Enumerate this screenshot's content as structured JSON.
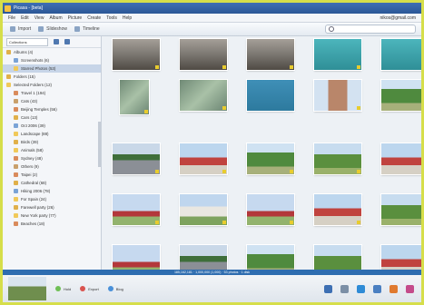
{
  "window": {
    "title": "Picasa - [beta]"
  },
  "menu": {
    "items": [
      "File",
      "Edit",
      "View",
      "Album",
      "Picture",
      "Create",
      "Tools",
      "Help"
    ],
    "account": "nikos@gmail.com"
  },
  "toolbar": {
    "buttons": [
      "Import",
      "Slideshow",
      "Timeline"
    ],
    "search_placeholder": ""
  },
  "sidebar": {
    "selector": "Collections",
    "items": [
      {
        "label": "Albums (4)"
      },
      {
        "label": "Screenshots (6)"
      },
      {
        "label": "Starred Photos (53)",
        "selected": true
      },
      {
        "label": "Folders (15)"
      },
      {
        "label": "Selected Folders (12)"
      },
      {
        "label": "Travel 1 (194)"
      },
      {
        "label": "Cats (43)"
      },
      {
        "label": "Beijing Temples (56)"
      },
      {
        "label": "Cars (13)"
      },
      {
        "label": "Oct 2006 (39)"
      },
      {
        "label": "Landscape (88)"
      },
      {
        "label": "Birds (39)"
      },
      {
        "label": "Animals (58)"
      },
      {
        "label": "Sydney (48)"
      },
      {
        "label": "Others (9)"
      },
      {
        "label": "Taipei (2)"
      },
      {
        "label": "Cathedral (68)"
      },
      {
        "label": "Hiking 2006 (78)"
      },
      {
        "label": "For Spain (24)"
      },
      {
        "label": "Farewell party (26)"
      },
      {
        "label": "New York party (77)"
      },
      {
        "label": "Beaches (18)"
      }
    ]
  },
  "gallery": {
    "thumbnails": [
      {
        "theme": "thumb-dusk",
        "tagged": true
      },
      {
        "theme": "thumb-dusk",
        "tagged": true
      },
      {
        "theme": "thumb-dusk",
        "tagged": true
      },
      {
        "theme": "thumb-teal",
        "tagged": true
      },
      {
        "theme": "thumb-teal",
        "tagged": true
      },
      {
        "theme": "thumb-aerial",
        "tagged": true
      },
      {
        "theme": "thumb-aerial",
        "tagged": true
      },
      {
        "theme": "thumb-water",
        "tagged": false
      },
      {
        "theme": "thumb-building",
        "tagged": true
      },
      {
        "theme": "thumb-park-tree",
        "tagged": true
      },
      {
        "theme": "thumb-road",
        "tagged": true
      },
      {
        "theme": "thumb-red-temple",
        "tagged": true
      },
      {
        "theme": "thumb-park-tree",
        "tagged": true
      },
      {
        "theme": "thumb-tree-lawn",
        "tagged": true
      },
      {
        "theme": "thumb-red-temple",
        "tagged": true
      },
      {
        "theme": "thumb-sky-temple",
        "tagged": true
      },
      {
        "theme": "thumb-white-bldg",
        "tagged": true
      },
      {
        "theme": "thumb-sky-temple",
        "tagged": true
      },
      {
        "theme": "thumb-red-temple",
        "tagged": true
      },
      {
        "theme": "thumb-tree-lawn",
        "tagged": true
      },
      {
        "theme": "thumb-sky-temple",
        "tagged": true
      },
      {
        "theme": "thumb-road",
        "tagged": true
      },
      {
        "theme": "thumb-park-tree",
        "tagged": true
      },
      {
        "theme": "thumb-tree-lawn",
        "tagged": true
      },
      {
        "theme": "thumb-red-temple",
        "tagged": true
      }
    ]
  },
  "status": {
    "text": "185,162,181 · 1,000,000 (1,000) · 53 photos · 1 disk"
  },
  "bottom": {
    "buttons": [
      "Hold",
      "Export",
      "Blog"
    ],
    "tray_icons": [
      "email-icon",
      "print-icon",
      "upload-icon",
      "order-icon",
      "collage-icon",
      "movie-icon"
    ]
  },
  "colors": {
    "accent": "#2f6db0",
    "title": "#3f6fb4",
    "tag": "#e8cc2e",
    "frame": "#d6de4a"
  }
}
